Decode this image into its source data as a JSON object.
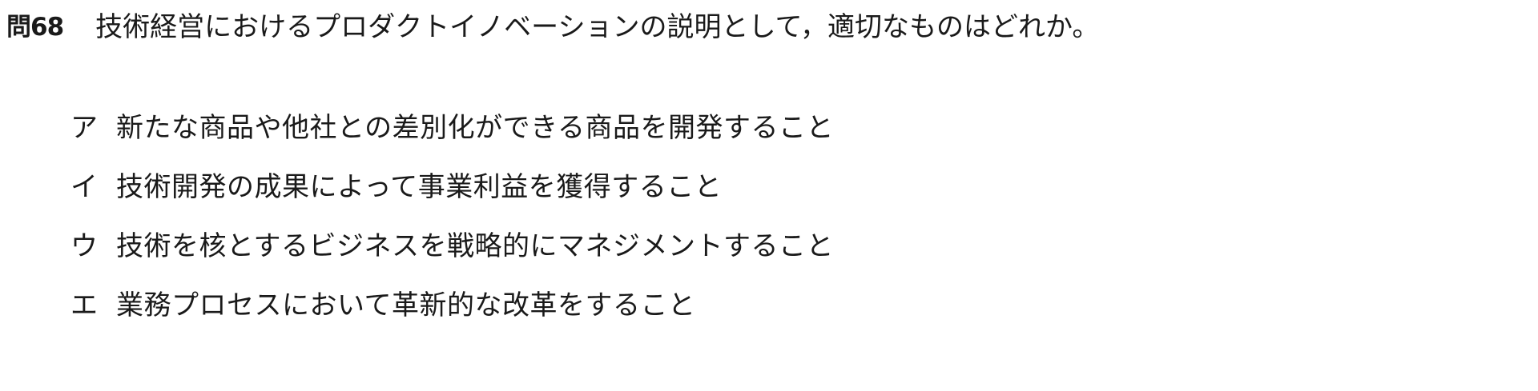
{
  "question": {
    "number": "問68",
    "text": "技術経営におけるプロダクトイノベーションの説明として，適切なものはどれか。"
  },
  "options": [
    {
      "label": "ア",
      "text": "新たな商品や他社との差別化ができる商品を開発すること"
    },
    {
      "label": "イ",
      "text": "技術開発の成果によって事業利益を獲得すること"
    },
    {
      "label": "ウ",
      "text": "技術を核とするビジネスを戦略的にマネジメントすること"
    },
    {
      "label": "エ",
      "text": "業務プロセスにおいて革新的な改革をすること"
    }
  ]
}
